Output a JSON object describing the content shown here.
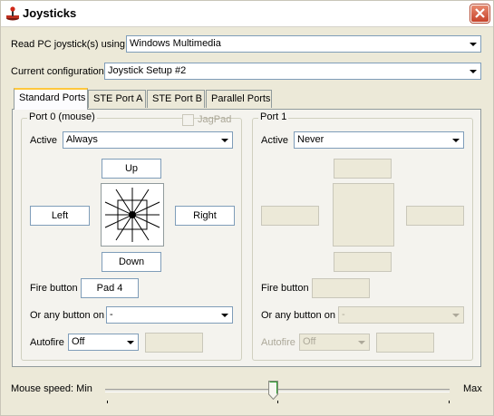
{
  "window": {
    "title": "Joysticks"
  },
  "read_using": {
    "label": "Read PC joystick(s) using",
    "value": "Windows Multimedia"
  },
  "configuration": {
    "label": "Current configuration",
    "value": "Joystick Setup #2"
  },
  "tabs": [
    {
      "label": "Standard Ports",
      "active": true
    },
    {
      "label": "STE Port A",
      "active": false
    },
    {
      "label": "STE Port B",
      "active": false
    },
    {
      "label": "Parallel Ports",
      "active": false
    }
  ],
  "port0": {
    "legend": "Port 0 (mouse)",
    "jagpad_label": "JagPad",
    "active_label": "Active",
    "active_value": "Always",
    "up": "Up",
    "down": "Down",
    "left": "Left",
    "right": "Right",
    "fire_label": "Fire button",
    "fire_value": "Pad 4",
    "any_button_label": "Or any button on",
    "any_button_value": "-",
    "autofire_label": "Autofire",
    "autofire_value": "Off",
    "autofire_extra": ""
  },
  "port1": {
    "legend": "Port 1",
    "active_label": "Active",
    "active_value": "Never",
    "up": "",
    "down": "",
    "left": "",
    "right": "",
    "fire_label": "Fire button",
    "fire_value": "",
    "any_button_label": "Or any button on",
    "any_button_value": "-",
    "autofire_label": "Autofire",
    "autofire_value": "Off",
    "autofire_extra": ""
  },
  "mouse_speed": {
    "label": "Mouse speed: Min",
    "max_label": "Max",
    "value_fraction": 0.5
  },
  "colors": {
    "title_icon": "#c03020",
    "close_button": "#d2553a",
    "tab_highlight": "#ffc73c"
  }
}
